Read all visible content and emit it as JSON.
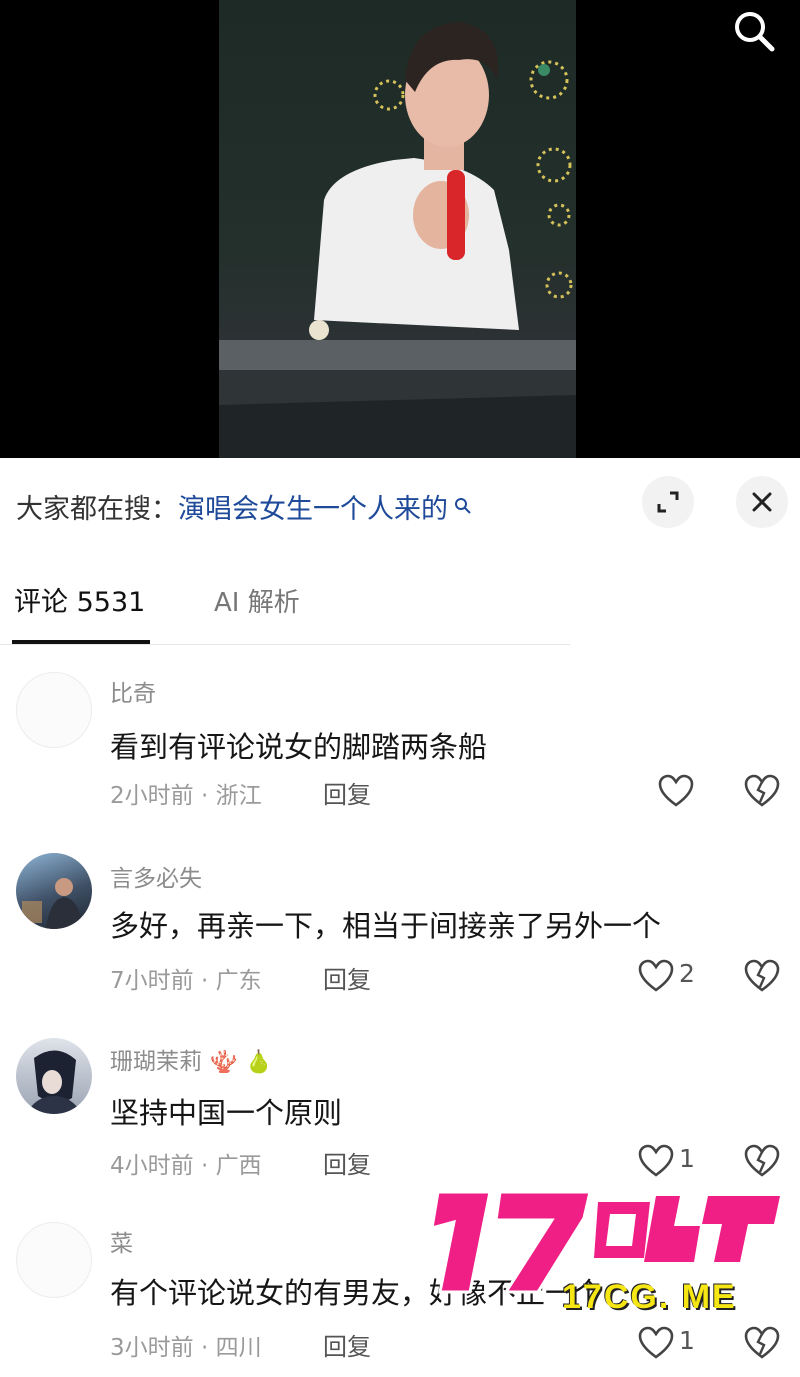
{
  "search_hint": {
    "prefix": "大家都在搜：",
    "query": "演唱会女生一个人来的"
  },
  "tabs": [
    {
      "label": "评论 5531",
      "active": true
    },
    {
      "label": "AI 解析",
      "active": false
    }
  ],
  "comments": [
    {
      "user": "比奇",
      "text": "看到有评论说女的脚踏两条船",
      "time_location": "2小时前 · 浙江",
      "reply_label": "回复",
      "likes": ""
    },
    {
      "user": "言多必失",
      "text": "多好，再亲一下，相当于间接亲了另外一个",
      "time_location": "7小时前 · 广东",
      "reply_label": "回复",
      "likes": "2"
    },
    {
      "user": "珊瑚茉莉",
      "text": "坚持中国一个原则",
      "time_location": "4小时前 · 广西",
      "reply_label": "回复",
      "likes": "1"
    },
    {
      "user": "菜",
      "text": "有个评论说女的有男友，好像不止一个",
      "time_location": "3小时前 · 四川",
      "reply_label": "回复",
      "likes": "1"
    }
  ],
  "watermark": {
    "logo": "17吃瓜",
    "site": "17CG. ME"
  },
  "colors": {
    "link": "#1f4a9a",
    "watermark_pink": "#ef1f86",
    "watermark_yellow": "#f5e614"
  }
}
